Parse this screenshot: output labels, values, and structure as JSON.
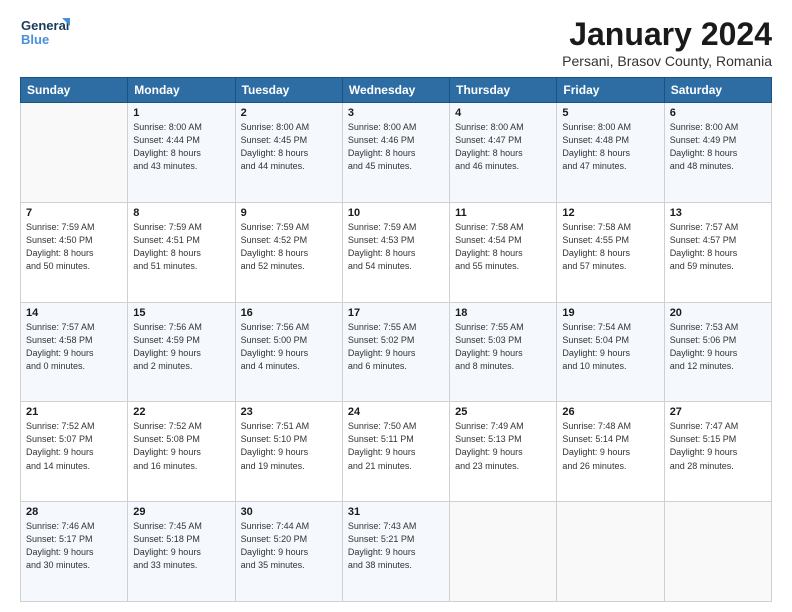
{
  "logo": {
    "line1": "General",
    "line2": "Blue"
  },
  "title": "January 2024",
  "location": "Persani, Brasov County, Romania",
  "header_days": [
    "Sunday",
    "Monday",
    "Tuesday",
    "Wednesday",
    "Thursday",
    "Friday",
    "Saturday"
  ],
  "weeks": [
    [
      {
        "day": "",
        "info": ""
      },
      {
        "day": "1",
        "info": "Sunrise: 8:00 AM\nSunset: 4:44 PM\nDaylight: 8 hours\nand 43 minutes."
      },
      {
        "day": "2",
        "info": "Sunrise: 8:00 AM\nSunset: 4:45 PM\nDaylight: 8 hours\nand 44 minutes."
      },
      {
        "day": "3",
        "info": "Sunrise: 8:00 AM\nSunset: 4:46 PM\nDaylight: 8 hours\nand 45 minutes."
      },
      {
        "day": "4",
        "info": "Sunrise: 8:00 AM\nSunset: 4:47 PM\nDaylight: 8 hours\nand 46 minutes."
      },
      {
        "day": "5",
        "info": "Sunrise: 8:00 AM\nSunset: 4:48 PM\nDaylight: 8 hours\nand 47 minutes."
      },
      {
        "day": "6",
        "info": "Sunrise: 8:00 AM\nSunset: 4:49 PM\nDaylight: 8 hours\nand 48 minutes."
      }
    ],
    [
      {
        "day": "7",
        "info": "Sunrise: 7:59 AM\nSunset: 4:50 PM\nDaylight: 8 hours\nand 50 minutes."
      },
      {
        "day": "8",
        "info": "Sunrise: 7:59 AM\nSunset: 4:51 PM\nDaylight: 8 hours\nand 51 minutes."
      },
      {
        "day": "9",
        "info": "Sunrise: 7:59 AM\nSunset: 4:52 PM\nDaylight: 8 hours\nand 52 minutes."
      },
      {
        "day": "10",
        "info": "Sunrise: 7:59 AM\nSunset: 4:53 PM\nDaylight: 8 hours\nand 54 minutes."
      },
      {
        "day": "11",
        "info": "Sunrise: 7:58 AM\nSunset: 4:54 PM\nDaylight: 8 hours\nand 55 minutes."
      },
      {
        "day": "12",
        "info": "Sunrise: 7:58 AM\nSunset: 4:55 PM\nDaylight: 8 hours\nand 57 minutes."
      },
      {
        "day": "13",
        "info": "Sunrise: 7:57 AM\nSunset: 4:57 PM\nDaylight: 8 hours\nand 59 minutes."
      }
    ],
    [
      {
        "day": "14",
        "info": "Sunrise: 7:57 AM\nSunset: 4:58 PM\nDaylight: 9 hours\nand 0 minutes."
      },
      {
        "day": "15",
        "info": "Sunrise: 7:56 AM\nSunset: 4:59 PM\nDaylight: 9 hours\nand 2 minutes."
      },
      {
        "day": "16",
        "info": "Sunrise: 7:56 AM\nSunset: 5:00 PM\nDaylight: 9 hours\nand 4 minutes."
      },
      {
        "day": "17",
        "info": "Sunrise: 7:55 AM\nSunset: 5:02 PM\nDaylight: 9 hours\nand 6 minutes."
      },
      {
        "day": "18",
        "info": "Sunrise: 7:55 AM\nSunset: 5:03 PM\nDaylight: 9 hours\nand 8 minutes."
      },
      {
        "day": "19",
        "info": "Sunrise: 7:54 AM\nSunset: 5:04 PM\nDaylight: 9 hours\nand 10 minutes."
      },
      {
        "day": "20",
        "info": "Sunrise: 7:53 AM\nSunset: 5:06 PM\nDaylight: 9 hours\nand 12 minutes."
      }
    ],
    [
      {
        "day": "21",
        "info": "Sunrise: 7:52 AM\nSunset: 5:07 PM\nDaylight: 9 hours\nand 14 minutes."
      },
      {
        "day": "22",
        "info": "Sunrise: 7:52 AM\nSunset: 5:08 PM\nDaylight: 9 hours\nand 16 minutes."
      },
      {
        "day": "23",
        "info": "Sunrise: 7:51 AM\nSunset: 5:10 PM\nDaylight: 9 hours\nand 19 minutes."
      },
      {
        "day": "24",
        "info": "Sunrise: 7:50 AM\nSunset: 5:11 PM\nDaylight: 9 hours\nand 21 minutes."
      },
      {
        "day": "25",
        "info": "Sunrise: 7:49 AM\nSunset: 5:13 PM\nDaylight: 9 hours\nand 23 minutes."
      },
      {
        "day": "26",
        "info": "Sunrise: 7:48 AM\nSunset: 5:14 PM\nDaylight: 9 hours\nand 26 minutes."
      },
      {
        "day": "27",
        "info": "Sunrise: 7:47 AM\nSunset: 5:15 PM\nDaylight: 9 hours\nand 28 minutes."
      }
    ],
    [
      {
        "day": "28",
        "info": "Sunrise: 7:46 AM\nSunset: 5:17 PM\nDaylight: 9 hours\nand 30 minutes."
      },
      {
        "day": "29",
        "info": "Sunrise: 7:45 AM\nSunset: 5:18 PM\nDaylight: 9 hours\nand 33 minutes."
      },
      {
        "day": "30",
        "info": "Sunrise: 7:44 AM\nSunset: 5:20 PM\nDaylight: 9 hours\nand 35 minutes."
      },
      {
        "day": "31",
        "info": "Sunrise: 7:43 AM\nSunset: 5:21 PM\nDaylight: 9 hours\nand 38 minutes."
      },
      {
        "day": "",
        "info": ""
      },
      {
        "day": "",
        "info": ""
      },
      {
        "day": "",
        "info": ""
      }
    ]
  ]
}
